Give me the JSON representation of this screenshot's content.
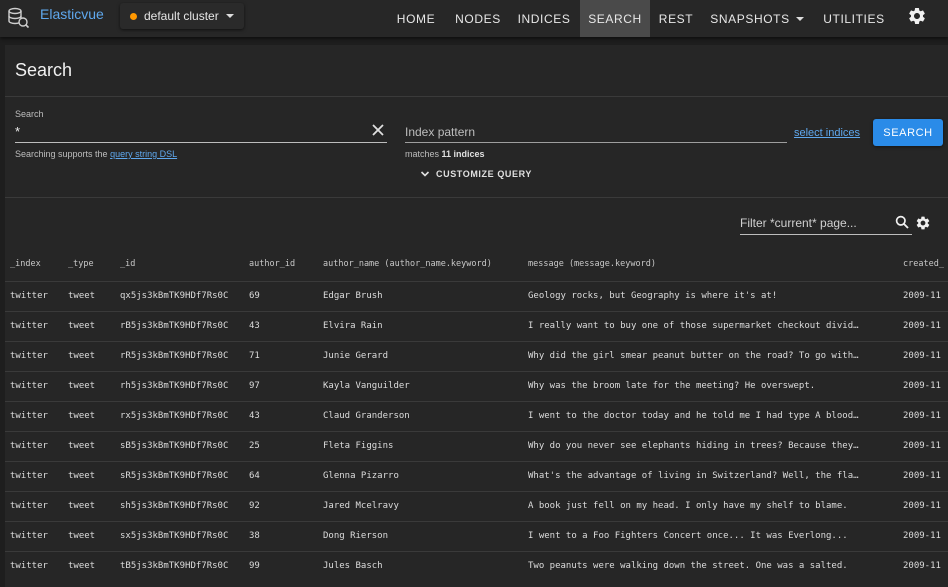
{
  "app": {
    "title": "Elasticvue",
    "cluster": "default cluster",
    "colors": {
      "accent": "#2a8be8",
      "link": "#5fa8ee",
      "cluster_status": "#ff9800"
    }
  },
  "nav": {
    "items": [
      {
        "label": "HOME"
      },
      {
        "label": "NODES"
      },
      {
        "label": "INDICES"
      },
      {
        "label": "SEARCH",
        "active": true
      },
      {
        "label": "REST"
      },
      {
        "label": "SNAPSHOTS",
        "dropdown": true
      },
      {
        "label": "UTILITIES"
      }
    ],
    "settings_icon": "gear-icon"
  },
  "page": {
    "title": "Search"
  },
  "search": {
    "label": "Search",
    "value": "*",
    "hint_prefix": "Searching supports the ",
    "hint_link": "query string DSL"
  },
  "index": {
    "placeholder": "Index pattern",
    "matches_prefix": "matches ",
    "matches_count": "11 indices",
    "select_link": "select indices",
    "search_button": "SEARCH"
  },
  "customize": {
    "label": "CUSTOMIZE QUERY"
  },
  "filter": {
    "placeholder": "Filter *current* page..."
  },
  "table": {
    "columns": [
      "_index",
      "_type",
      "_id",
      "author_id",
      "author_name (author_name.keyword)",
      "message (message.keyword)",
      "created_"
    ],
    "rows": [
      [
        "twitter",
        "tweet",
        "qx5js3kBmTK9HDf7Rs0C",
        "69",
        "Edgar Brush",
        "Geology rocks, but Geography is where it's at!",
        "2009-11"
      ],
      [
        "twitter",
        "tweet",
        "rB5js3kBmTK9HDf7Rs0C",
        "43",
        "Elvira Rain",
        "I really want to buy one of those supermarket checkout divid…",
        "2009-11"
      ],
      [
        "twitter",
        "tweet",
        "rR5js3kBmTK9HDf7Rs0C",
        "71",
        "Junie Gerard",
        "Why did the girl smear peanut butter on the road? To go with…",
        "2009-11"
      ],
      [
        "twitter",
        "tweet",
        "rh5js3kBmTK9HDf7Rs0C",
        "97",
        "Kayla Vanguilder",
        "Why was the broom late for the meeting? He overswept.",
        "2009-11"
      ],
      [
        "twitter",
        "tweet",
        "rx5js3kBmTK9HDf7Rs0C",
        "43",
        "Claud Granderson",
        "I went to the doctor today and he told me I had type A blood…",
        "2009-11"
      ],
      [
        "twitter",
        "tweet",
        "sB5js3kBmTK9HDf7Rs0C",
        "25",
        "Fleta Figgins",
        "Why do you never see elephants hiding in trees? Because they…",
        "2009-11"
      ],
      [
        "twitter",
        "tweet",
        "sR5js3kBmTK9HDf7Rs0C",
        "64",
        "Glenna Pizarro",
        "What's the advantage of living in Switzerland? Well, the fla…",
        "2009-11"
      ],
      [
        "twitter",
        "tweet",
        "sh5js3kBmTK9HDf7Rs0C",
        "92",
        "Jared Mcelravy",
        "A book just fell on my head. I only have my shelf to blame.",
        "2009-11"
      ],
      [
        "twitter",
        "tweet",
        "sx5js3kBmTK9HDf7Rs0C",
        "38",
        "Dong Rierson",
        "I went to a Foo Fighters Concert once... It was Everlong...",
        "2009-11"
      ],
      [
        "twitter",
        "tweet",
        "tB5js3kBmTK9HDf7Rs0C",
        "99",
        "Jules Basch",
        "Two peanuts were walking down the street. One was a salted.",
        "2009-11"
      ]
    ]
  }
}
